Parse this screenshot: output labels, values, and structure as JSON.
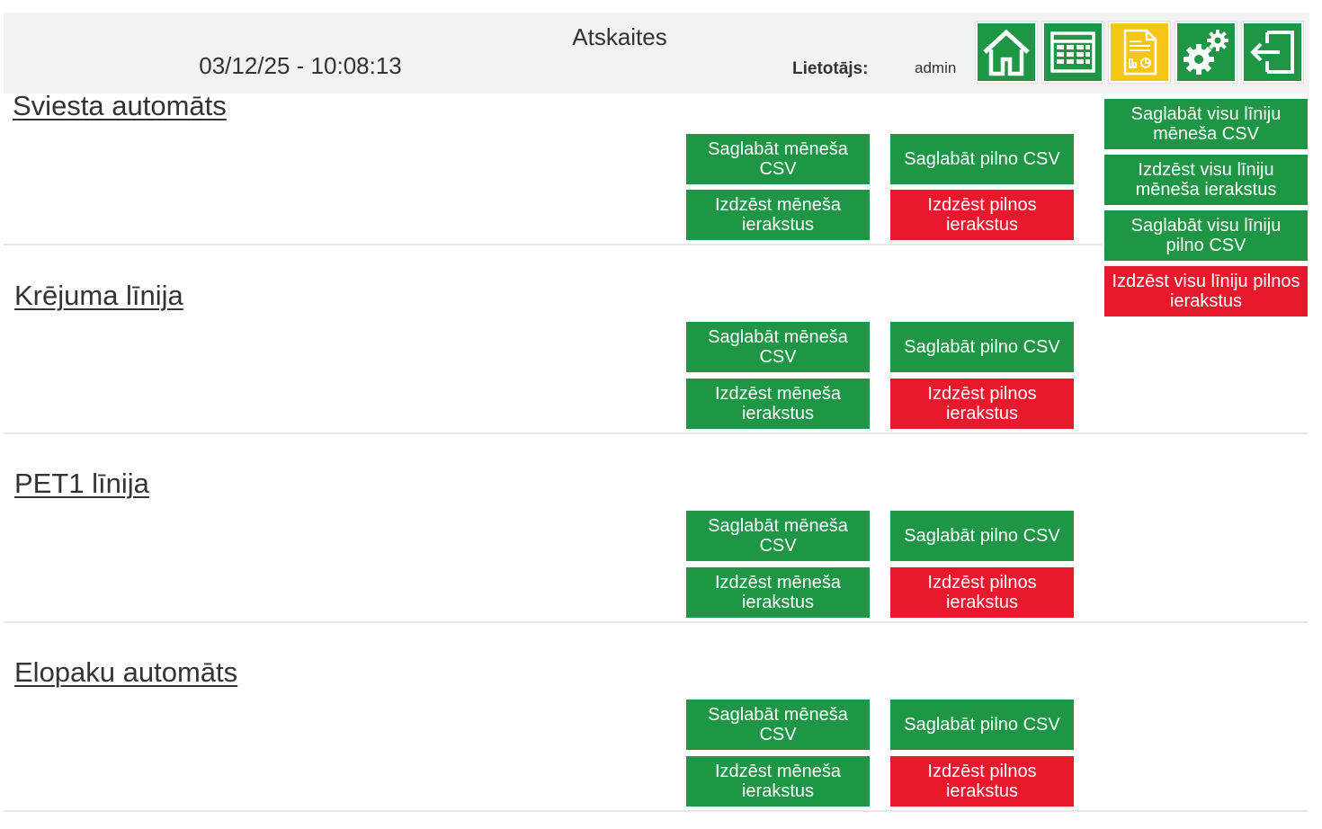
{
  "header": {
    "title": "Atskaites",
    "datetime": "03/12/25 - 10:08:13",
    "user_label": "Lietotājs:",
    "user_value": "admin"
  },
  "nav": [
    {
      "icon": "home-icon",
      "name": "nav-home-button",
      "color": "#1e9645"
    },
    {
      "icon": "table-icon",
      "name": "nav-table-button",
      "color": "#1e9645"
    },
    {
      "icon": "report-icon",
      "name": "nav-reports-button",
      "color": "#f5c518"
    },
    {
      "icon": "gears-icon",
      "name": "nav-settings-button",
      "color": "#1e9645"
    },
    {
      "icon": "logout-icon",
      "name": "nav-logout-button",
      "color": "#1e9645"
    }
  ],
  "colors": {
    "green": "#1e9645",
    "red": "#e8192c",
    "active": "#f5c518"
  },
  "sections": [
    {
      "title": "Sviesta automāts",
      "save_month": "Saglabāt mēneša CSV",
      "save_full": "Saglabāt pilno CSV",
      "delete_month": "Izdzēst mēneša ierakstus",
      "delete_full": "Izdzēst pilnos ierakstus"
    },
    {
      "title": "Krējuma līnija",
      "save_month": "Saglabāt mēneša CSV",
      "save_full": "Saglabāt pilno CSV",
      "delete_month": "Izdzēst mēneša ierakstus",
      "delete_full": "Izdzēst pilnos ierakstus"
    },
    {
      "title": "PET1 līnija",
      "save_month": "Saglabāt mēneša CSV",
      "save_full": "Saglabāt pilno CSV",
      "delete_month": "Izdzēst mēneša ierakstus",
      "delete_full": "Izdzēst pilnos ierakstus"
    },
    {
      "title": "Elopaku automāts",
      "save_month": "Saglabāt mēneša CSV",
      "save_full": "Saglabāt pilno CSV",
      "delete_month": "Izdzēst mēneša ierakstus",
      "delete_full": "Izdzēst pilnos ierakstus"
    }
  ],
  "global_actions": {
    "save_all_month": "Saglabāt visu līniju mēneša CSV",
    "delete_all_month": "Izdzēst visu līniju mēneša ierakstus",
    "save_all_full": "Saglabāt visu līniju pilno CSV",
    "delete_all_full": "Izdzēst visu līniju pilnos ierakstus"
  }
}
